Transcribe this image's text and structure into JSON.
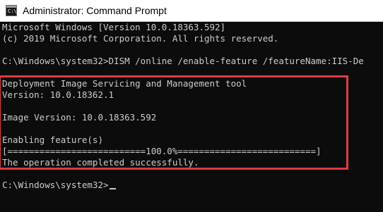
{
  "window": {
    "title": "Administrator: Command Prompt",
    "icon": "command-prompt-icon",
    "icon_glyph": "C:\\"
  },
  "console": {
    "lines": [
      "Microsoft Windows [Version 10.0.18363.592]",
      "(c) 2019 Microsoft Corporation. All rights reserved.",
      "",
      "C:\\Windows\\system32>DISM /online /enable-feature /featureName:IIS-De",
      "",
      "Deployment Image Servicing and Management tool",
      "Version: 10.0.18362.1",
      "",
      "Image Version: 10.0.18363.592",
      "",
      "Enabling feature(s)",
      "[==========================100.0%==========================]",
      "The operation completed successfully.",
      "",
      "C:\\Windows\\system32>"
    ]
  },
  "colors": {
    "console_background": "#0c0c0c",
    "console_text": "#cccccc",
    "highlight_border": "#e03c3c",
    "titlebar_background": "#ffffff"
  }
}
